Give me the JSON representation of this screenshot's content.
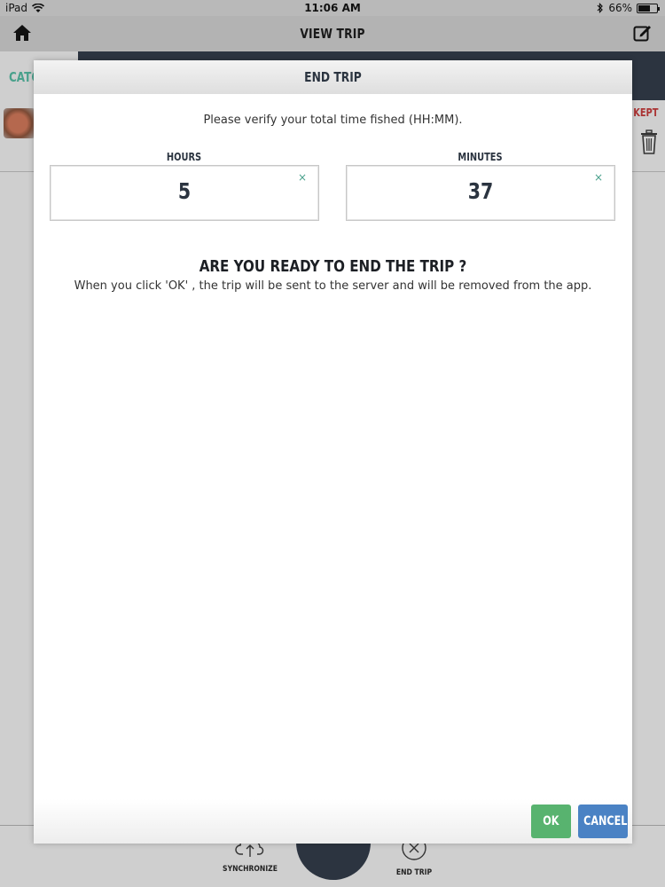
{
  "status_bar": {
    "device": "iPad",
    "time": "11:06 AM",
    "battery_percent": "66%",
    "battery_level": 0.66
  },
  "nav": {
    "title": "VIEW TRIP"
  },
  "background": {
    "catch_label": "CATC",
    "kept_label": "KEPT"
  },
  "bottom_bar": {
    "synchronize": "SYNCHRONIZE",
    "end_trip": "END TRIP"
  },
  "modal": {
    "title": "END TRIP",
    "prompt": "Please verify your total time fished (HH:MM).",
    "hours": {
      "label": "HOURS",
      "value": "5",
      "clear": "×"
    },
    "minutes": {
      "label": "MINUTES",
      "value": "37",
      "clear": "×"
    },
    "confirm_heading": "ARE YOU READY TO END THE TRIP ?",
    "confirm_note": "When you click 'OK' , the trip will be sent to the server and will be removed from the app.",
    "ok_label": "OK",
    "cancel_label": "CANCEL"
  },
  "colors": {
    "accent_green": "#58b36f",
    "accent_blue": "#4a82c4",
    "teal": "#4aa18c",
    "dark_navy": "#2c3440"
  }
}
